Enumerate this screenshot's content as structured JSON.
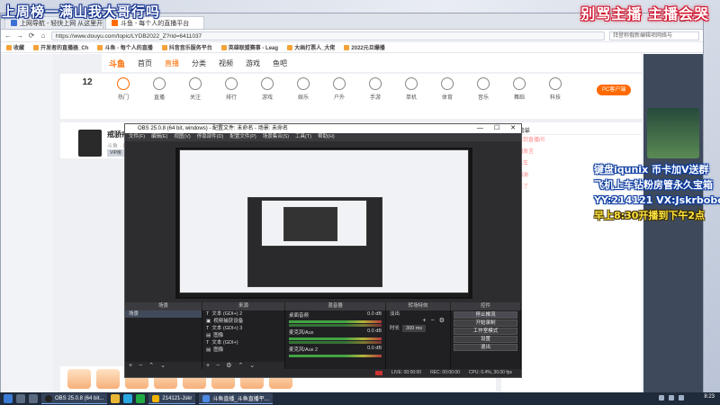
{
  "overlays": {
    "top_left": "上周榜一满山我大哥行吗",
    "top_right": "别骂主播 主播会哭",
    "right_lines": [
      "键盘iqunix 币卡加V送群",
      "飞机上车钻粉房管永久宝箱",
      "YY:214121 VX:Jskrbobo",
      "早上8:30开播到下午2点"
    ]
  },
  "browser": {
    "tabs": [
      {
        "label": "上网导航 - 轻快上网 从这里开始",
        "color": "#3b6fd4"
      },
      {
        "label": "斗鱼 - 每个人的直播平台",
        "color": "#ff6a00",
        "active": true
      }
    ],
    "window_controls": [
      "—",
      "☐",
      "✕"
    ],
    "nav": {
      "back": "←",
      "forward": "→",
      "refresh": "⟳",
      "home": "⌂"
    },
    "url": "https://www.douyu.com/topic/LYDB2022_Z?rid=6411037",
    "search_placeholder": "拜登称俄新编辑项网络与",
    "bookmarks": [
      "收藏",
      "开发者的直播器_Ch",
      "斗鱼 - 每个人的直播",
      "抖音音乐服务平台",
      "英雄联盟赛事 - Leag",
      "大画打票人_大佬",
      "2022元旦爆播"
    ]
  },
  "douyu": {
    "logo": "斗鱼",
    "nav_items": [
      "首页",
      "直播",
      "分类",
      "视频",
      "游戏",
      "鱼吧"
    ],
    "active_nav": "直播",
    "categories": [
      "12",
      "热门",
      "直播",
      "关注",
      "排行",
      "游戏",
      "娱乐",
      "户外",
      "手游",
      "单机",
      "体育",
      "音乐",
      "舞蹈",
      "科技"
    ],
    "subscribe": "PC客户端",
    "room": {
      "name": "戒骄戒躁 以德服人",
      "meta": "斗鱼 · 绝地求生 · 直上直...",
      "tag": "VIP房"
    },
    "chat": {
      "header": "主播榜单",
      "lines": [
        "欢迎来到直播间",
        "请文明发言",
        "飞机上车",
        "主播加油",
        "来了来了"
      ]
    }
  },
  "obs": {
    "title": "OBS 25.0.8 (64 bit, windows) - 配置文件: 未命名 - 场景: 未命名",
    "menu": [
      "文件(F)",
      "编辑(E)",
      "视图(V)",
      "停靠部件(D)",
      "配置文件(P)",
      "场景集合(S)",
      "工具(T)",
      "帮助(H)"
    ],
    "panels": [
      "场景",
      "来源",
      "混音器",
      "转场特效",
      "控件"
    ],
    "scenes": [
      "场景"
    ],
    "sources": [
      "文本 (GDI+) 2",
      "视频捕获设备",
      "文本 (GDI+) 3",
      "图像",
      "文本 (GDI+)",
      "图像"
    ],
    "mixer": [
      {
        "name": "桌面音频",
        "level": "0.0 dB"
      },
      {
        "name": "麦克风/Aux",
        "level": "0.0 dB"
      },
      {
        "name": "麦克风/Aux 2",
        "level": "0.0 dB"
      }
    ],
    "transition": {
      "type": "淡出",
      "duration_label": "时长",
      "duration": "300 ms"
    },
    "controls": [
      "停止推流",
      "开始录制",
      "工作室模式",
      "设置",
      "退出"
    ],
    "status": {
      "live": "LIVE: 00:00:00",
      "rec": "REC: 00:00:00",
      "cpu": "CPU: 0.4%, 30.00 fps"
    }
  },
  "taskbar": {
    "tasks": [
      "OBS 25.0.8 (64 bit...",
      "214121-Jskr",
      "斗鱼直播_斗鱼直播平..."
    ],
    "clock": "8:23"
  }
}
